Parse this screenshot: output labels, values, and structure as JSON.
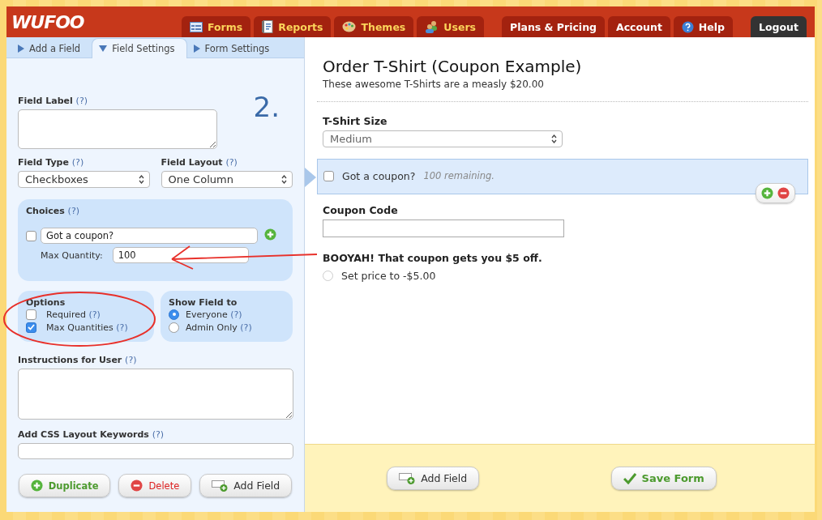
{
  "logo": "WUFOO",
  "nav": [
    {
      "label": "Forms",
      "kind": "main"
    },
    {
      "label": "Reports",
      "kind": "main"
    },
    {
      "label": "Themes",
      "kind": "main"
    },
    {
      "label": "Users",
      "kind": "main"
    },
    {
      "label": "Plans & Pricing",
      "kind": "account"
    },
    {
      "label": "Account",
      "kind": "account"
    },
    {
      "label": "Help",
      "kind": "account"
    },
    {
      "label": "Logout",
      "kind": "logout"
    }
  ],
  "panel_tabs": [
    {
      "label": "Add a Field",
      "selected": false
    },
    {
      "label": "Field Settings",
      "selected": true
    },
    {
      "label": "Form Settings",
      "selected": false
    }
  ],
  "step_number": "2.",
  "help_mark": "(?)",
  "field_label": {
    "label": "Field Label"
  },
  "field_type": {
    "label": "Field Type",
    "value": "Checkboxes"
  },
  "field_layout": {
    "label": "Field Layout",
    "value": "One Column"
  },
  "choices": {
    "title": "Choices",
    "items": [
      {
        "value": "Got a coupon?",
        "checked": false,
        "quantity_label": "Max Quantity:",
        "quantity": "100"
      }
    ]
  },
  "options": {
    "title": "Options",
    "items": [
      {
        "label": "Required",
        "checked": false
      },
      {
        "label": "Max Quantities",
        "checked": true
      }
    ]
  },
  "show_field_to": {
    "title": "Show Field to",
    "items": [
      {
        "label": "Everyone",
        "selected": true
      },
      {
        "label": "Admin Only",
        "selected": false
      }
    ]
  },
  "instructions": {
    "label": "Instructions for User"
  },
  "css_keywords": {
    "label": "Add CSS Layout Keywords"
  },
  "panel_buttons": [
    {
      "label": "Duplicate",
      "kind": "duplicate"
    },
    {
      "label": "Delete",
      "kind": "delete"
    },
    {
      "label": "Add Field",
      "kind": "add"
    }
  ],
  "form": {
    "title": "Order T-Shirt (Coupon Example)",
    "description": "These awesome T-Shirts are a measly $20.00",
    "fields": [
      {
        "kind": "select",
        "label": "T-Shirt Size",
        "value": "Medium"
      },
      {
        "kind": "checkbox",
        "label": "Got a coupon?",
        "note": "100 remaining.",
        "checked": false,
        "selected": true
      },
      {
        "kind": "text",
        "label": "Coupon Code"
      },
      {
        "kind": "radio",
        "label": "BOOYAH! That coupon gets you $5 off.",
        "option": "Set price to -$5.00",
        "checked": false
      }
    ]
  },
  "footer_buttons": [
    {
      "label": "Add Field",
      "kind": "add"
    },
    {
      "label": "Save Form",
      "kind": "save"
    }
  ]
}
